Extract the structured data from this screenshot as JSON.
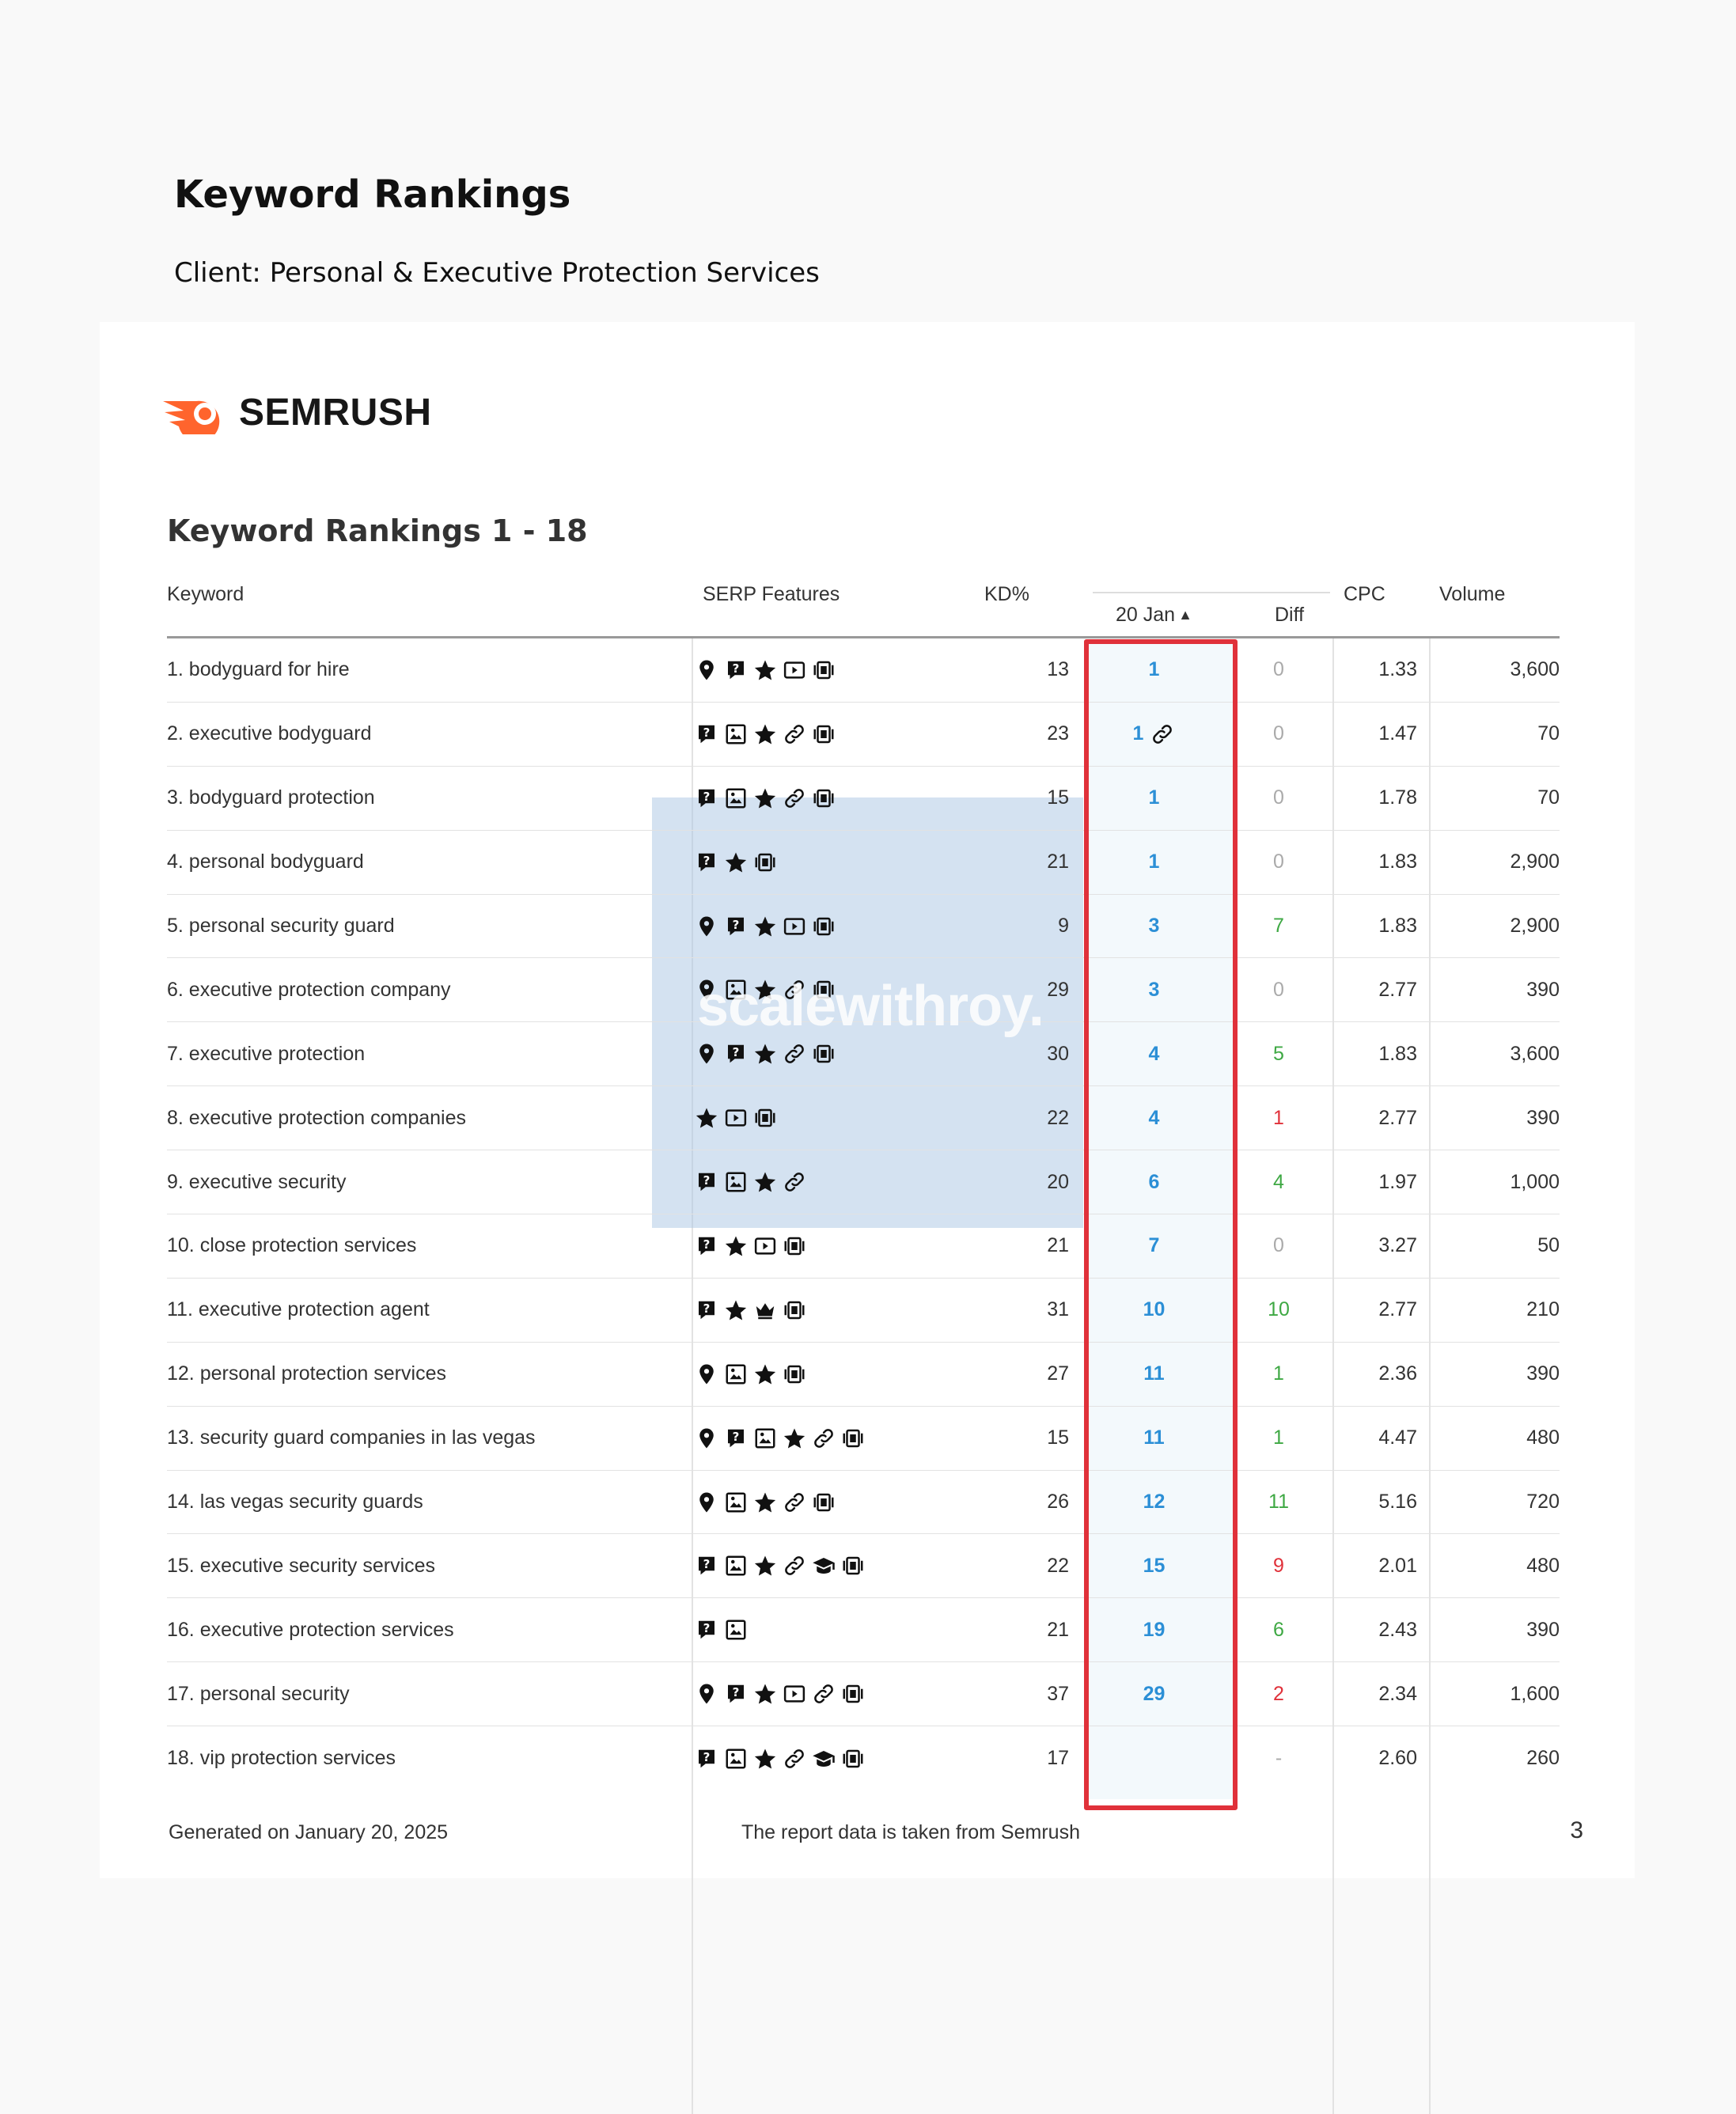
{
  "page": {
    "title": "Keyword Rankings",
    "client": "Client: Personal & Executive Protection Services"
  },
  "brand": {
    "name": "SEMRUSH",
    "accent": "#ff642d"
  },
  "section_title": "Keyword Rankings 1 - 18",
  "columns": {
    "keyword": "Keyword",
    "serp": "SERP Features",
    "kd": "KD%",
    "date": "20 Jan",
    "diff": "Diff",
    "cpc": "CPC",
    "volume": "Volume"
  },
  "rows": [
    {
      "keyword": "1. bodyguard for hire",
      "serp": [
        "pin",
        "faq",
        "star",
        "video",
        "carousel"
      ],
      "kd": "13",
      "pos": "1",
      "link": false,
      "diff": "0",
      "cpc": "1.33",
      "vol": "3,600"
    },
    {
      "keyword": "2. executive bodyguard",
      "serp": [
        "faq",
        "image",
        "star",
        "link",
        "carousel"
      ],
      "kd": "23",
      "pos": "1",
      "link": true,
      "diff": "0",
      "cpc": "1.47",
      "vol": "70"
    },
    {
      "keyword": "3. bodyguard protection",
      "serp": [
        "faq",
        "image",
        "star",
        "link",
        "carousel"
      ],
      "kd": "15",
      "pos": "1",
      "link": false,
      "diff": "0",
      "cpc": "1.78",
      "vol": "70"
    },
    {
      "keyword": "4. personal bodyguard",
      "serp": [
        "faq",
        "star",
        "carousel"
      ],
      "kd": "21",
      "pos": "1",
      "link": false,
      "diff": "0",
      "cpc": "1.83",
      "vol": "2,900"
    },
    {
      "keyword": "5. personal security guard",
      "serp": [
        "pin",
        "faq",
        "star",
        "video",
        "carousel"
      ],
      "kd": "9",
      "pos": "3",
      "link": false,
      "diff": "7",
      "cpc": "1.83",
      "vol": "2,900"
    },
    {
      "keyword": "6. executive protection company",
      "serp": [
        "pin",
        "image",
        "star",
        "link",
        "carousel"
      ],
      "kd": "29",
      "pos": "3",
      "link": false,
      "diff": "0",
      "cpc": "2.77",
      "vol": "390"
    },
    {
      "keyword": "7. executive protection",
      "serp": [
        "pin",
        "faq",
        "star",
        "link",
        "carousel"
      ],
      "kd": "30",
      "pos": "4",
      "link": false,
      "diff": "5",
      "cpc": "1.83",
      "vol": "3,600"
    },
    {
      "keyword": "8. executive protection companies",
      "serp": [
        "star",
        "video",
        "carousel"
      ],
      "kd": "22",
      "pos": "4",
      "link": false,
      "diff": "1",
      "cpc": "2.77",
      "vol": "390"
    },
    {
      "keyword": "9. executive security",
      "serp": [
        "faq",
        "image",
        "star",
        "link"
      ],
      "kd": "20",
      "pos": "6",
      "link": false,
      "diff": "4",
      "cpc": "1.97",
      "vol": "1,000"
    },
    {
      "keyword": "10. close protection services",
      "serp": [
        "faq",
        "star",
        "video",
        "carousel"
      ],
      "kd": "21",
      "pos": "7",
      "link": false,
      "diff": "0",
      "cpc": "3.27",
      "vol": "50"
    },
    {
      "keyword": "11. executive protection agent",
      "serp": [
        "faq",
        "star",
        "crown",
        "carousel"
      ],
      "kd": "31",
      "pos": "10",
      "link": false,
      "diff": "10",
      "cpc": "2.77",
      "vol": "210"
    },
    {
      "keyword": "12. personal protection services",
      "serp": [
        "pin",
        "image",
        "star",
        "carousel"
      ],
      "kd": "27",
      "pos": "11",
      "link": false,
      "diff": "1",
      "cpc": "2.36",
      "vol": "390"
    },
    {
      "keyword": "13. security guard companies in las vegas",
      "serp": [
        "pin",
        "faq",
        "image",
        "star",
        "link",
        "carousel"
      ],
      "kd": "15",
      "pos": "11",
      "link": false,
      "diff": "1",
      "cpc": "4.47",
      "vol": "480"
    },
    {
      "keyword": "14. las vegas security guards",
      "serp": [
        "pin",
        "image",
        "star",
        "link",
        "carousel"
      ],
      "kd": "26",
      "pos": "12",
      "link": false,
      "diff": "11",
      "cpc": "5.16",
      "vol": "720"
    },
    {
      "keyword": "15. executive security services",
      "serp": [
        "faq",
        "image",
        "star",
        "link",
        "cap",
        "carousel"
      ],
      "kd": "22",
      "pos": "15",
      "link": false,
      "diff": "9",
      "cpc": "2.01",
      "vol": "480"
    },
    {
      "keyword": "16. executive protection services",
      "serp": [
        "faq",
        "image"
      ],
      "kd": "21",
      "pos": "19",
      "link": false,
      "diff": "6",
      "cpc": "2.43",
      "vol": "390"
    },
    {
      "keyword": "17. personal security",
      "serp": [
        "pin",
        "faq",
        "star",
        "video",
        "link",
        "carousel"
      ],
      "kd": "37",
      "pos": "29",
      "link": false,
      "diff": "2",
      "cpc": "2.34",
      "vol": "1,600"
    },
    {
      "keyword": "18. vip protection services",
      "serp": [
        "faq",
        "image",
        "star",
        "link",
        "cap",
        "carousel"
      ],
      "kd": "17",
      "pos": "",
      "link": false,
      "diff": "-",
      "cpc": "2.60",
      "vol": "260"
    }
  ],
  "diff_colors": [
    "neutral",
    "neutral",
    "neutral",
    "neutral",
    "up",
    "neutral",
    "up",
    "down",
    "up",
    "neutral",
    "up",
    "up",
    "up",
    "up",
    "down",
    "up",
    "down",
    "neutral"
  ],
  "colors": {
    "up": "#3ea843",
    "down": "#e0313a",
    "neutral": "#aaaaaa",
    "position": "#2b8fd6",
    "highlight": "#e0313a"
  },
  "watermark": "scalewithroy.",
  "footer": {
    "generated": "Generated on January 20, 2025",
    "source": "The report data is taken from Semrush",
    "page_number": "3"
  }
}
